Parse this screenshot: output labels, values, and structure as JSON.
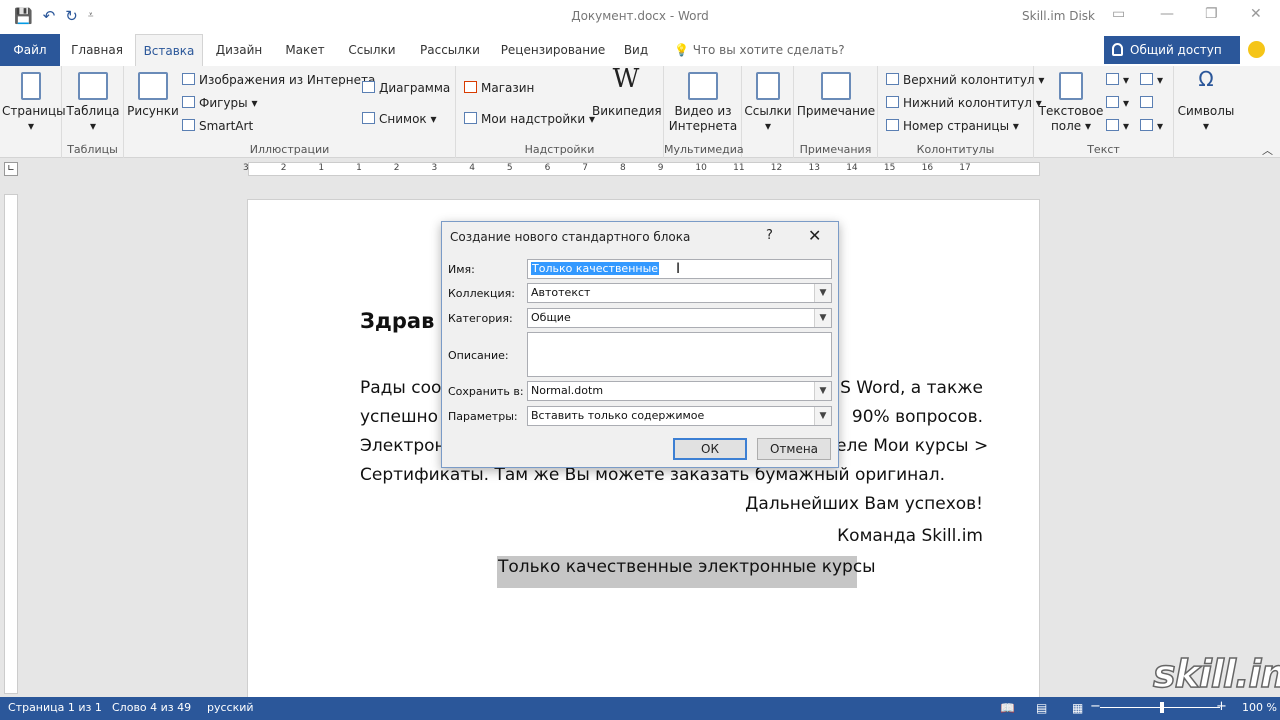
{
  "window": {
    "title": "Документ.docx - Word",
    "user": "Skill.im Disk"
  },
  "tabs": [
    "Файл",
    "Главная",
    "Вставка",
    "Дизайн",
    "Макет",
    "Ссылки",
    "Рассылки",
    "Рецензирование",
    "Вид"
  ],
  "tell_me": "Что вы хотите сделать?",
  "share": "Общий доступ",
  "ribbon": {
    "pages": "Страницы",
    "table": "Таблица",
    "tables_group": "Таблицы",
    "pictures": "Рисунки",
    "online_pictures": "Изображения из Интернета",
    "shapes": "Фигуры",
    "smartart": "SmartArt",
    "chart": "Диаграмма",
    "screenshot": "Снимок",
    "illustrations_group": "Иллюстрации",
    "store": "Магазин",
    "my_addins": "Мои надстройки",
    "wikipedia": "Википедия",
    "addins_group": "Надстройки",
    "online_video_1": "Видео из",
    "online_video_2": "Интернета",
    "media_group": "Мультимедиа",
    "links": "Ссылки",
    "comment": "Примечание",
    "comments_group": "Примечания",
    "header": "Верхний колонтитул",
    "footer": "Нижний колонтитул",
    "page_number": "Номер страницы",
    "header_footer_group": "Колонтитулы",
    "textbox_1": "Текстовое",
    "textbox_2": "поле",
    "text_group": "Текст",
    "symbols": "Символы"
  },
  "ruler": {
    "numbers": [
      "3",
      "2",
      "1",
      "1",
      "2",
      "3",
      "4",
      "5",
      "6",
      "7",
      "8",
      "9",
      "10",
      "11",
      "12",
      "13",
      "14",
      "15",
      "16",
      "17"
    ]
  },
  "doc": {
    "heading": "Здрав",
    "line1a": "Рады  соо",
    "line1b": "S  Word,  а  также",
    "line2a": "успешно",
    "line2b": "90%   вопросов.",
    "line3a": "Электрон",
    "line3b": "еле Мои курсы >",
    "line4": "Сертификаты. Там же Вы можете заказать бумажный оригинал.",
    "line5": "Дальнейших Вам успехов!",
    "line6": "Команда Skill.im",
    "selected": "Только качественные электронные курсы"
  },
  "dialog": {
    "title": "Создание нового стандартного блока",
    "help": "?",
    "name_label": "Имя:",
    "name_value": "Только качественные",
    "gallery_label": "Коллекция:",
    "gallery_value": "Автотекст",
    "category_label": "Категория:",
    "category_value": "Общие",
    "description_label": "Описание:",
    "save_in_label": "Сохранить в:",
    "save_in_value": "Normal.dotm",
    "options_label": "Параметры:",
    "options_value": "Вставить только содержимое",
    "ok": "ОК",
    "cancel": "Отмена"
  },
  "status": {
    "page": "Страница 1 из 1",
    "words": "Слово 4 из 49",
    "lang": "русский",
    "zoom": "100 %"
  },
  "watermark": "skill.im",
  "colors": {
    "accent": "#2b579a",
    "selection": "#3399ff"
  }
}
